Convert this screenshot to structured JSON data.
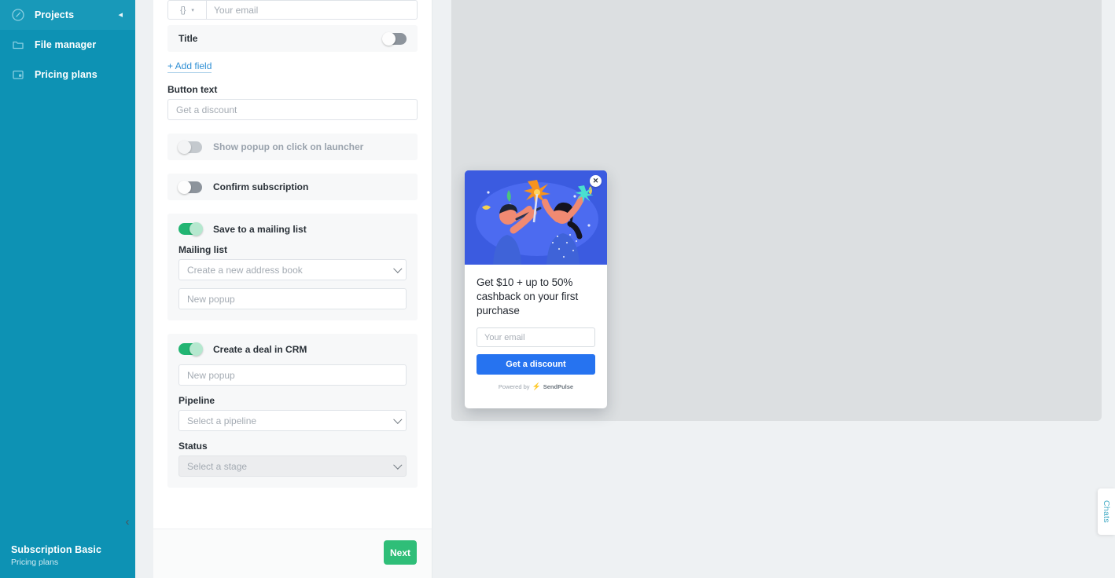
{
  "sidebar": {
    "items": [
      {
        "label": "Projects",
        "icon": "clock-circle-icon",
        "active": true
      },
      {
        "label": "File manager",
        "icon": "folder-icon",
        "active": false
      },
      {
        "label": "Pricing plans",
        "icon": "card-window-icon",
        "active": false
      }
    ],
    "collapse_glyph": "◂",
    "footer": {
      "title": "Subscription Basic",
      "subtitle": "Pricing plans"
    },
    "collapse_chevron": "‹"
  },
  "panel": {
    "email_field": {
      "prefix_icon": "{}",
      "caret": "▾",
      "placeholder": "Your email"
    },
    "title_row": {
      "label": "Title",
      "toggle": "off"
    },
    "add_field": "+ Add field",
    "button_text": {
      "label": "Button text",
      "value": "Get a discount"
    },
    "show_on_launcher": {
      "label": "Show popup on click on launcher",
      "toggle": "off-disabled"
    },
    "confirm_subscription": {
      "label": "Confirm subscription",
      "toggle": "off"
    },
    "mailing": {
      "toggle_label": "Save to a mailing list",
      "toggle": "on",
      "list_label": "Mailing list",
      "list_value": "Create a new address book",
      "name_value": "New popup"
    },
    "crm": {
      "toggle_label": "Create a deal in CRM",
      "toggle": "on",
      "deal_name": "New popup",
      "pipeline_label": "Pipeline",
      "pipeline_value": "Select a pipeline",
      "status_label": "Status",
      "status_value": "Select a stage"
    },
    "next_button": "Next"
  },
  "preview": {
    "close_glyph": "✕",
    "headline": "Get $10 + up to 50% cashback on your first purchase",
    "email_placeholder": "Your email",
    "cta_label": "Get a discount",
    "powered_prefix": "Powered by",
    "powered_bolt": "⚡",
    "powered_brand": "SendPulse"
  },
  "chats_tab": {
    "label": "Chats"
  },
  "colors": {
    "sidebar": "#0d92b4",
    "sidebar_active": "#1899b9",
    "toggle_on": "#22b573",
    "next_button": "#2fbe78",
    "cta_blue": "#2673f0",
    "hero_blue": "#3b5be0",
    "link_blue": "#2f8fd4",
    "chats_teal": "#3fa9c4",
    "bolt_orange": "#f2803c"
  }
}
